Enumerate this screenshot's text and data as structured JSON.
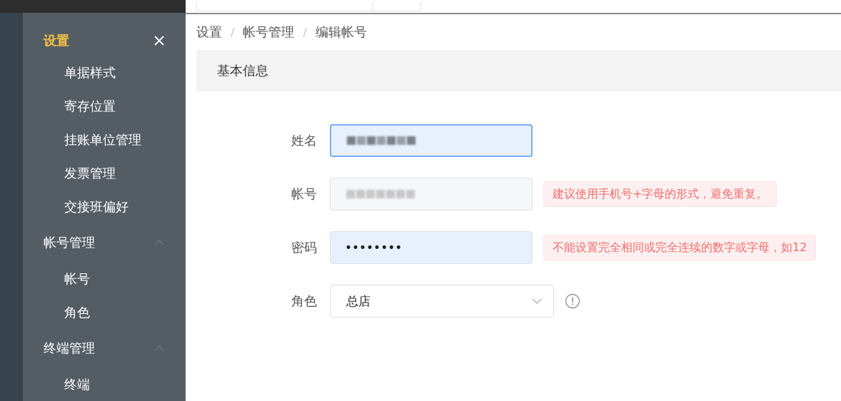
{
  "sidebar": {
    "title": "设置",
    "menu": [
      {
        "kind": "item",
        "label": "单据样式"
      },
      {
        "kind": "item",
        "label": "寄存位置"
      },
      {
        "kind": "item",
        "label": "挂账单位管理"
      },
      {
        "kind": "item",
        "label": "发票管理"
      },
      {
        "kind": "item",
        "label": "交接班偏好"
      },
      {
        "kind": "group",
        "label": "帐号管理",
        "expanded": true,
        "children": [
          {
            "kind": "item",
            "label": "帐号"
          },
          {
            "kind": "item",
            "label": "角色"
          }
        ]
      },
      {
        "kind": "group",
        "label": "终端管理",
        "expanded": true,
        "children": [
          {
            "kind": "item",
            "label": "终端"
          }
        ]
      }
    ]
  },
  "breadcrumb": {
    "separator": "/",
    "items": [
      "设置",
      "帐号管理",
      "编辑帐号"
    ]
  },
  "section": {
    "title": "基本信息"
  },
  "form": [
    {
      "kind": "text",
      "label": "姓名",
      "blurred": true,
      "focused": true,
      "disabled": false
    },
    {
      "kind": "text",
      "label": "帐号",
      "blurred": true,
      "focused": false,
      "disabled": true,
      "hint": "建议使用手机号+字母的形式，避免重复。"
    },
    {
      "kind": "password",
      "label": "密码",
      "value": "••••••••",
      "focused": false,
      "disabled": false,
      "autofilled": true,
      "hint": "不能设置完全相同或完全连续的数字或字母，如12"
    },
    {
      "kind": "select",
      "label": "角色",
      "value": "总店",
      "info": true
    }
  ]
}
